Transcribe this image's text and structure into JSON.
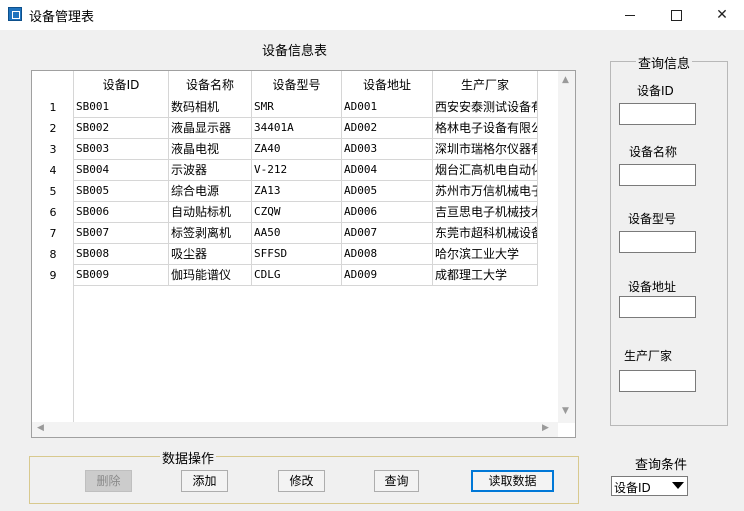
{
  "window": {
    "title": "设备管理表"
  },
  "grid": {
    "caption": "设备信息表",
    "columns": [
      "设备ID",
      "设备名称",
      "设备型号",
      "设备地址",
      "生产厂家"
    ],
    "rows": [
      {
        "num": "1",
        "id": "SB001",
        "name": "数码相机",
        "model": "SMR",
        "addr": "AD001",
        "maker": "西安安泰测试设备有"
      },
      {
        "num": "2",
        "id": "SB002",
        "name": "液晶显示器",
        "model": "34401A",
        "addr": "AD002",
        "maker": "格林电子设备有限公"
      },
      {
        "num": "3",
        "id": "SB003",
        "name": "液晶电视",
        "model": "ZA40",
        "addr": "AD003",
        "maker": "深圳市瑞格尔仪器有"
      },
      {
        "num": "4",
        "id": "SB004",
        "name": "示波器",
        "model": "V-212",
        "addr": "AD004",
        "maker": "烟台汇高机电自动化"
      },
      {
        "num": "5",
        "id": "SB005",
        "name": "综合电源",
        "model": "ZA13",
        "addr": "AD005",
        "maker": "苏州市万信机械电子"
      },
      {
        "num": "6",
        "id": "SB006",
        "name": "自动贴标机",
        "model": "CZQW",
        "addr": "AD006",
        "maker": "吉亘思电子机械技术"
      },
      {
        "num": "7",
        "id": "SB007",
        "name": "标签剥离机",
        "model": "AA50",
        "addr": "AD007",
        "maker": "东莞市超科机械设备"
      },
      {
        "num": "8",
        "id": "SB008",
        "name": "吸尘器",
        "model": "SFFSD",
        "addr": "AD008",
        "maker": "哈尔滨工业大学"
      },
      {
        "num": "9",
        "id": "SB009",
        "name": "伽玛能谱仪",
        "model": "CDLG",
        "addr": "AD009",
        "maker": "成都理工大学"
      }
    ]
  },
  "operations": {
    "legend": "数据操作",
    "delete": "删除",
    "add": "添加",
    "edit": "修改",
    "query": "查询",
    "read": "读取数据"
  },
  "query_panel": {
    "legend": "查询信息",
    "labels": [
      "设备ID",
      "设备名称",
      "设备型号",
      "设备地址",
      "生产厂家"
    ],
    "values": [
      "",
      "",
      "",
      "",
      ""
    ]
  },
  "condition": {
    "label": "查询条件",
    "selected": "设备ID"
  }
}
